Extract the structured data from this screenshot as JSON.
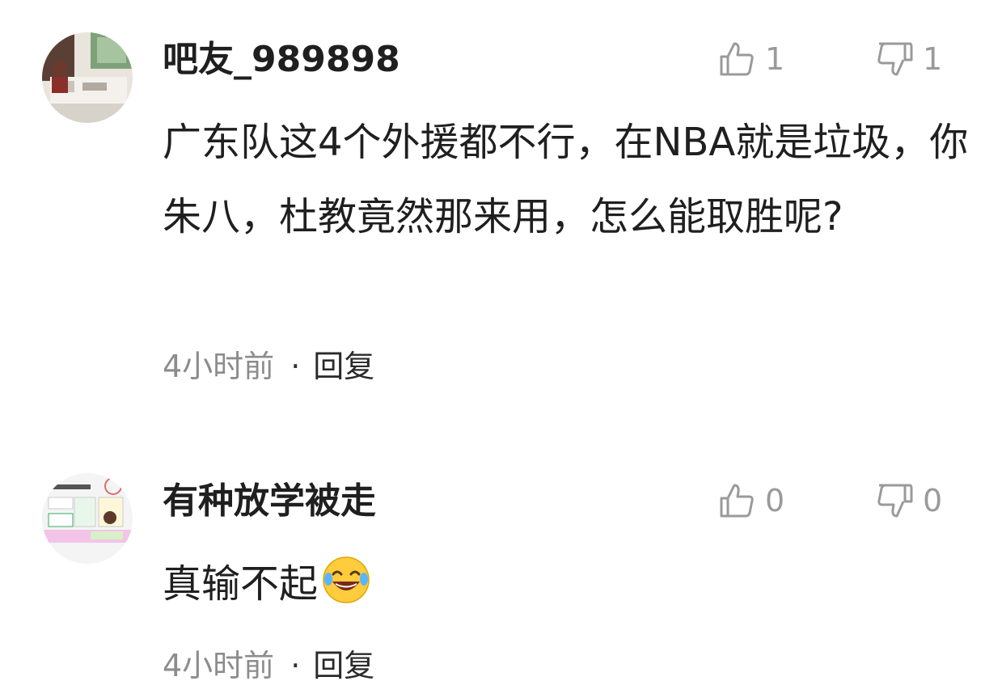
{
  "comments": [
    {
      "username": "吧友_989898",
      "likes": "1",
      "dislikes": "1",
      "text": "广东队这4个外援都不行，在NBA就是垃圾，你朱八，杜教竟然那来用，怎么能取胜呢?",
      "time": "4小时前",
      "separator": "·",
      "reply_label": "回复",
      "avatar_icon": "office-photo-avatar"
    },
    {
      "username": "有种放学被走",
      "likes": "0",
      "dislikes": "0",
      "text": "真输不起",
      "emoji": "laughing-crying-emoji",
      "time": "4小时前",
      "separator": "·",
      "reply_label": "回复",
      "avatar_icon": "game-card-avatar"
    }
  ],
  "colors": {
    "text_primary": "#1f1f1f",
    "text_muted": "#8c8c8c",
    "icon_gray": "#9a9a9a",
    "background": "#ffffff"
  }
}
